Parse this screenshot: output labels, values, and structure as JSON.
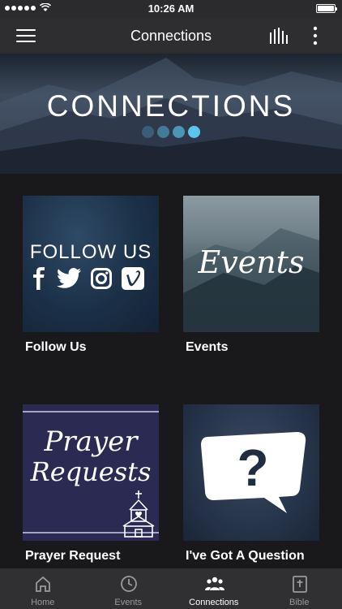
{
  "status_bar": {
    "time": "10:26 AM"
  },
  "nav": {
    "title": "Connections",
    "menu_icon": "hamburger-icon",
    "stats_icon": "bar-chart-icon",
    "more_icon": "more-vertical-icon"
  },
  "hero": {
    "title": "CONNECTIONS",
    "pager_colors": [
      "#3a5d78",
      "#437a98",
      "#4b95b6",
      "#5ac6ee"
    ],
    "active_page": 4
  },
  "tiles": [
    {
      "label": "Follow Us",
      "image_text": "FOLLOW US",
      "icons": [
        "facebook-icon",
        "twitter-icon",
        "instagram-icon",
        "vimeo-icon"
      ]
    },
    {
      "label": "Events",
      "image_text": "Events"
    },
    {
      "label": "Prayer Request",
      "image_text_line1": "Prayer",
      "image_text_line2": "Requests"
    },
    {
      "label": "I've Got A Question",
      "image_text": "?"
    }
  ],
  "tab_bar": {
    "items": [
      {
        "label": "Home",
        "icon": "home-icon"
      },
      {
        "label": "Events",
        "icon": "clock-icon"
      },
      {
        "label": "Connections",
        "icon": "people-icon",
        "active": true
      },
      {
        "label": "Bible",
        "icon": "bible-icon"
      }
    ]
  },
  "colors": {
    "accent": "#5ac6ee",
    "background": "#19191b",
    "nav": "#2e2e30",
    "tab_bar": "#303033"
  }
}
